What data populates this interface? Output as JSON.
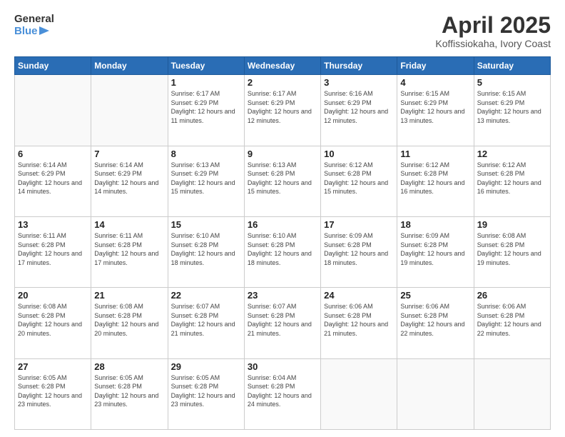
{
  "header": {
    "logo_line1": "General",
    "logo_line2": "Blue",
    "month_title": "April 2025",
    "location": "Koffissiokaha, Ivory Coast"
  },
  "weekdays": [
    "Sunday",
    "Monday",
    "Tuesday",
    "Wednesday",
    "Thursday",
    "Friday",
    "Saturday"
  ],
  "weeks": [
    [
      {
        "day": "",
        "sunrise": "",
        "sunset": "",
        "daylight": ""
      },
      {
        "day": "",
        "sunrise": "",
        "sunset": "",
        "daylight": ""
      },
      {
        "day": "1",
        "sunrise": "Sunrise: 6:17 AM",
        "sunset": "Sunset: 6:29 PM",
        "daylight": "Daylight: 12 hours and 11 minutes."
      },
      {
        "day": "2",
        "sunrise": "Sunrise: 6:17 AM",
        "sunset": "Sunset: 6:29 PM",
        "daylight": "Daylight: 12 hours and 12 minutes."
      },
      {
        "day": "3",
        "sunrise": "Sunrise: 6:16 AM",
        "sunset": "Sunset: 6:29 PM",
        "daylight": "Daylight: 12 hours and 12 minutes."
      },
      {
        "day": "4",
        "sunrise": "Sunrise: 6:15 AM",
        "sunset": "Sunset: 6:29 PM",
        "daylight": "Daylight: 12 hours and 13 minutes."
      },
      {
        "day": "5",
        "sunrise": "Sunrise: 6:15 AM",
        "sunset": "Sunset: 6:29 PM",
        "daylight": "Daylight: 12 hours and 13 minutes."
      }
    ],
    [
      {
        "day": "6",
        "sunrise": "Sunrise: 6:14 AM",
        "sunset": "Sunset: 6:29 PM",
        "daylight": "Daylight: 12 hours and 14 minutes."
      },
      {
        "day": "7",
        "sunrise": "Sunrise: 6:14 AM",
        "sunset": "Sunset: 6:29 PM",
        "daylight": "Daylight: 12 hours and 14 minutes."
      },
      {
        "day": "8",
        "sunrise": "Sunrise: 6:13 AM",
        "sunset": "Sunset: 6:29 PM",
        "daylight": "Daylight: 12 hours and 15 minutes."
      },
      {
        "day": "9",
        "sunrise": "Sunrise: 6:13 AM",
        "sunset": "Sunset: 6:28 PM",
        "daylight": "Daylight: 12 hours and 15 minutes."
      },
      {
        "day": "10",
        "sunrise": "Sunrise: 6:12 AM",
        "sunset": "Sunset: 6:28 PM",
        "daylight": "Daylight: 12 hours and 15 minutes."
      },
      {
        "day": "11",
        "sunrise": "Sunrise: 6:12 AM",
        "sunset": "Sunset: 6:28 PM",
        "daylight": "Daylight: 12 hours and 16 minutes."
      },
      {
        "day": "12",
        "sunrise": "Sunrise: 6:12 AM",
        "sunset": "Sunset: 6:28 PM",
        "daylight": "Daylight: 12 hours and 16 minutes."
      }
    ],
    [
      {
        "day": "13",
        "sunrise": "Sunrise: 6:11 AM",
        "sunset": "Sunset: 6:28 PM",
        "daylight": "Daylight: 12 hours and 17 minutes."
      },
      {
        "day": "14",
        "sunrise": "Sunrise: 6:11 AM",
        "sunset": "Sunset: 6:28 PM",
        "daylight": "Daylight: 12 hours and 17 minutes."
      },
      {
        "day": "15",
        "sunrise": "Sunrise: 6:10 AM",
        "sunset": "Sunset: 6:28 PM",
        "daylight": "Daylight: 12 hours and 18 minutes."
      },
      {
        "day": "16",
        "sunrise": "Sunrise: 6:10 AM",
        "sunset": "Sunset: 6:28 PM",
        "daylight": "Daylight: 12 hours and 18 minutes."
      },
      {
        "day": "17",
        "sunrise": "Sunrise: 6:09 AM",
        "sunset": "Sunset: 6:28 PM",
        "daylight": "Daylight: 12 hours and 18 minutes."
      },
      {
        "day": "18",
        "sunrise": "Sunrise: 6:09 AM",
        "sunset": "Sunset: 6:28 PM",
        "daylight": "Daylight: 12 hours and 19 minutes."
      },
      {
        "day": "19",
        "sunrise": "Sunrise: 6:08 AM",
        "sunset": "Sunset: 6:28 PM",
        "daylight": "Daylight: 12 hours and 19 minutes."
      }
    ],
    [
      {
        "day": "20",
        "sunrise": "Sunrise: 6:08 AM",
        "sunset": "Sunset: 6:28 PM",
        "daylight": "Daylight: 12 hours and 20 minutes."
      },
      {
        "day": "21",
        "sunrise": "Sunrise: 6:08 AM",
        "sunset": "Sunset: 6:28 PM",
        "daylight": "Daylight: 12 hours and 20 minutes."
      },
      {
        "day": "22",
        "sunrise": "Sunrise: 6:07 AM",
        "sunset": "Sunset: 6:28 PM",
        "daylight": "Daylight: 12 hours and 21 minutes."
      },
      {
        "day": "23",
        "sunrise": "Sunrise: 6:07 AM",
        "sunset": "Sunset: 6:28 PM",
        "daylight": "Daylight: 12 hours and 21 minutes."
      },
      {
        "day": "24",
        "sunrise": "Sunrise: 6:06 AM",
        "sunset": "Sunset: 6:28 PM",
        "daylight": "Daylight: 12 hours and 21 minutes."
      },
      {
        "day": "25",
        "sunrise": "Sunrise: 6:06 AM",
        "sunset": "Sunset: 6:28 PM",
        "daylight": "Daylight: 12 hours and 22 minutes."
      },
      {
        "day": "26",
        "sunrise": "Sunrise: 6:06 AM",
        "sunset": "Sunset: 6:28 PM",
        "daylight": "Daylight: 12 hours and 22 minutes."
      }
    ],
    [
      {
        "day": "27",
        "sunrise": "Sunrise: 6:05 AM",
        "sunset": "Sunset: 6:28 PM",
        "daylight": "Daylight: 12 hours and 23 minutes."
      },
      {
        "day": "28",
        "sunrise": "Sunrise: 6:05 AM",
        "sunset": "Sunset: 6:28 PM",
        "daylight": "Daylight: 12 hours and 23 minutes."
      },
      {
        "day": "29",
        "sunrise": "Sunrise: 6:05 AM",
        "sunset": "Sunset: 6:28 PM",
        "daylight": "Daylight: 12 hours and 23 minutes."
      },
      {
        "day": "30",
        "sunrise": "Sunrise: 6:04 AM",
        "sunset": "Sunset: 6:28 PM",
        "daylight": "Daylight: 12 hours and 24 minutes."
      },
      {
        "day": "",
        "sunrise": "",
        "sunset": "",
        "daylight": ""
      },
      {
        "day": "",
        "sunrise": "",
        "sunset": "",
        "daylight": ""
      },
      {
        "day": "",
        "sunrise": "",
        "sunset": "",
        "daylight": ""
      }
    ]
  ]
}
